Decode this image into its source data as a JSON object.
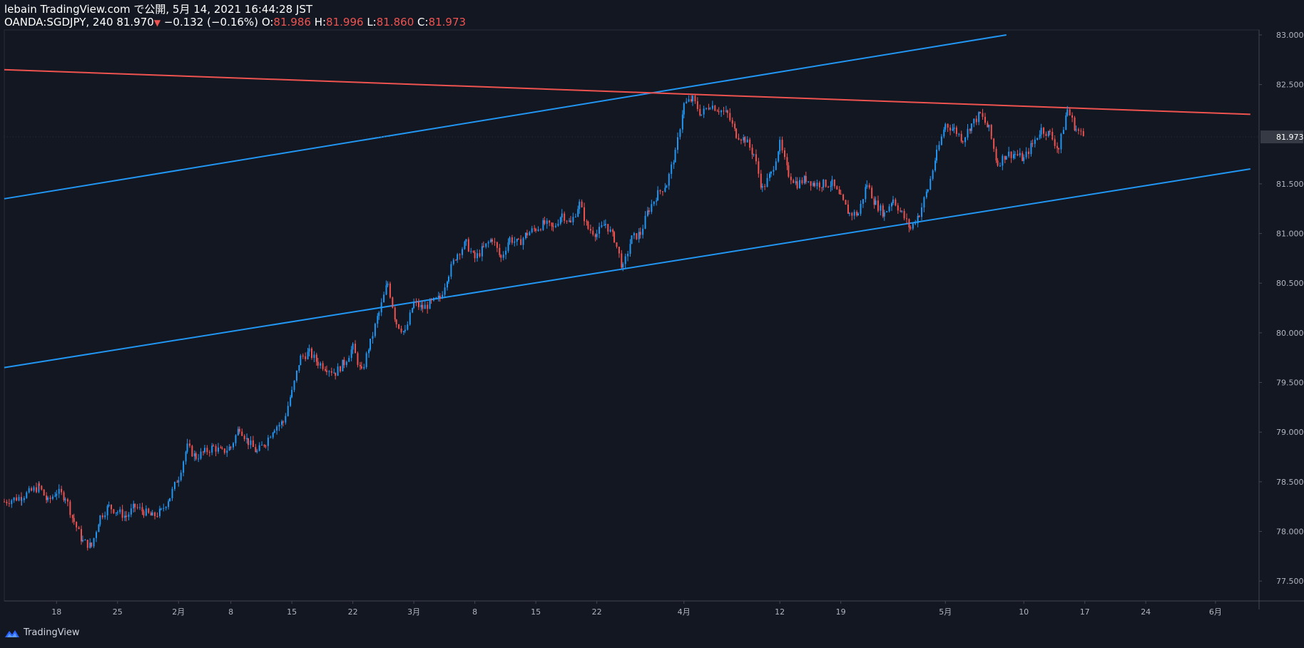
{
  "header": {
    "published": "lebain TradingView.com で公開, 5月 14, 2021 16:44:28 JST",
    "symbol": "OANDA:SGDJPY, 240",
    "price": "81.970",
    "change_arrow": "▼",
    "change": "−0.132 (−0.16%)",
    "o_label": "O:",
    "o_value": "81.986",
    "h_label": "H:",
    "h_value": "81.996",
    "l_label": "L:",
    "l_value": "81.860",
    "c_label": "C:",
    "c_value": "81.973"
  },
  "footer": {
    "brand": "TradingView",
    "logo_icon": "tradingview-logo-icon"
  },
  "colors": {
    "background": "#131722",
    "up": "#2196f3",
    "down": "#ef5350",
    "axis_text": "#b2b5be",
    "price_tag_bg": "#363a45"
  },
  "chart_data": {
    "type": "candlestick",
    "symbol": "OANDA:SGDJPY",
    "interval": "240",
    "last_price_label": "81.973",
    "y_ticks": [
      "83.000",
      "82.500",
      "81.500",
      "81.000",
      "80.500",
      "80.000",
      "79.500",
      "79.000",
      "78.500",
      "78.000",
      "77.500"
    ],
    "ylim": [
      77.3,
      83.05
    ],
    "x_ticks": [
      {
        "label": "18",
        "day": 4
      },
      {
        "label": "25",
        "day": 11
      },
      {
        "label": "2月",
        "day": 18
      },
      {
        "label": "8",
        "day": 24
      },
      {
        "label": "15",
        "day": 31
      },
      {
        "label": "22",
        "day": 38
      },
      {
        "label": "3月",
        "day": 45
      },
      {
        "label": "8",
        "day": 52
      },
      {
        "label": "15",
        "day": 59
      },
      {
        "label": "22",
        "day": 66
      },
      {
        "label": "4月",
        "day": 76
      },
      {
        "label": "12",
        "day": 87
      },
      {
        "label": "19",
        "day": 94
      },
      {
        "label": "5月",
        "day": 106
      },
      {
        "label": "10",
        "day": 115
      },
      {
        "label": "17",
        "day": 122
      },
      {
        "label": "24",
        "day": 129
      },
      {
        "label": "6月",
        "day": 137
      }
    ],
    "xlim": [
      -2,
      142
    ],
    "series": [
      {
        "name": "close_path",
        "points": [
          [
            -2,
            78.3
          ],
          [
            0,
            78.35
          ],
          [
            2,
            78.45
          ],
          [
            3,
            78.3
          ],
          [
            4,
            78.4
          ],
          [
            5,
            78.35
          ],
          [
            6,
            78.1
          ],
          [
            7,
            77.9
          ],
          [
            8,
            77.85
          ],
          [
            9,
            78.15
          ],
          [
            10,
            78.25
          ],
          [
            11,
            78.2
          ],
          [
            12,
            78.15
          ],
          [
            13,
            78.25
          ],
          [
            14,
            78.2
          ],
          [
            15,
            78.15
          ],
          [
            16,
            78.2
          ],
          [
            17,
            78.35
          ],
          [
            18,
            78.55
          ],
          [
            19,
            78.85
          ],
          [
            20,
            78.75
          ],
          [
            21,
            78.8
          ],
          [
            22,
            78.85
          ],
          [
            23,
            78.8
          ],
          [
            24,
            78.85
          ],
          [
            25,
            79.05
          ],
          [
            26,
            78.9
          ],
          [
            27,
            78.8
          ],
          [
            28,
            78.9
          ],
          [
            29,
            79.05
          ],
          [
            30,
            79.1
          ],
          [
            31,
            79.4
          ],
          [
            32,
            79.75
          ],
          [
            33,
            79.8
          ],
          [
            34,
            79.7
          ],
          [
            35,
            79.65
          ],
          [
            36,
            79.6
          ],
          [
            37,
            79.7
          ],
          [
            38,
            79.85
          ],
          [
            39,
            79.6
          ],
          [
            40,
            79.9
          ],
          [
            41,
            80.2
          ],
          [
            42,
            80.5
          ],
          [
            43,
            80.1
          ],
          [
            44,
            80.0
          ],
          [
            45,
            80.3
          ],
          [
            46,
            80.25
          ],
          [
            47,
            80.3
          ],
          [
            48,
            80.35
          ],
          [
            49,
            80.6
          ],
          [
            50,
            80.8
          ],
          [
            51,
            80.9
          ],
          [
            52,
            80.75
          ],
          [
            53,
            80.85
          ],
          [
            54,
            80.95
          ],
          [
            55,
            80.75
          ],
          [
            56,
            80.95
          ],
          [
            57,
            80.9
          ],
          [
            58,
            81.0
          ],
          [
            59,
            81.05
          ],
          [
            60,
            81.1
          ],
          [
            61,
            81.05
          ],
          [
            62,
            81.2
          ],
          [
            63,
            81.1
          ],
          [
            64,
            81.3
          ],
          [
            65,
            81.05
          ],
          [
            66,
            81.0
          ],
          [
            67,
            81.1
          ],
          [
            68,
            80.95
          ],
          [
            69,
            80.65
          ],
          [
            70,
            80.95
          ],
          [
            71,
            81.0
          ],
          [
            72,
            81.25
          ],
          [
            73,
            81.4
          ],
          [
            74,
            81.5
          ],
          [
            75,
            81.8
          ],
          [
            76,
            82.3
          ],
          [
            77,
            82.35
          ],
          [
            78,
            82.2
          ],
          [
            79,
            82.3
          ],
          [
            80,
            82.25
          ],
          [
            81,
            82.2
          ],
          [
            82,
            82.0
          ],
          [
            83,
            81.95
          ],
          [
            84,
            81.8
          ],
          [
            85,
            81.45
          ],
          [
            86,
            81.6
          ],
          [
            87,
            81.9
          ],
          [
            88,
            81.6
          ],
          [
            89,
            81.5
          ],
          [
            90,
            81.55
          ],
          [
            91,
            81.5
          ],
          [
            92,
            81.5
          ],
          [
            93,
            81.5
          ],
          [
            94,
            81.35
          ],
          [
            95,
            81.2
          ],
          [
            96,
            81.2
          ],
          [
            97,
            81.5
          ],
          [
            98,
            81.3
          ],
          [
            99,
            81.2
          ],
          [
            100,
            81.35
          ],
          [
            101,
            81.2
          ],
          [
            102,
            81.05
          ],
          [
            103,
            81.2
          ],
          [
            104,
            81.45
          ],
          [
            105,
            81.8
          ],
          [
            106,
            82.1
          ],
          [
            107,
            82.05
          ],
          [
            108,
            81.95
          ],
          [
            109,
            82.1
          ],
          [
            110,
            82.2
          ],
          [
            111,
            82.05
          ],
          [
            112,
            81.7
          ],
          [
            113,
            81.8
          ],
          [
            114,
            81.8
          ],
          [
            115,
            81.75
          ],
          [
            116,
            81.9
          ],
          [
            117,
            82.05
          ],
          [
            118,
            82.0
          ],
          [
            119,
            81.85
          ],
          [
            120,
            82.25
          ],
          [
            121,
            82.05
          ],
          [
            122,
            81.97
          ]
        ]
      }
    ],
    "trendlines": [
      {
        "name": "upper-blue-channel",
        "color": "#2196f3",
        "from": [
          -2,
          81.35
        ],
        "to": [
          113,
          83.0
        ]
      },
      {
        "name": "lower-blue-channel",
        "color": "#2196f3",
        "from": [
          -2,
          79.65
        ],
        "to": [
          141,
          81.65
        ]
      },
      {
        "name": "red-resistance",
        "color": "#ef5350",
        "from": [
          -2,
          82.65
        ],
        "to": [
          141,
          82.2
        ]
      }
    ]
  }
}
